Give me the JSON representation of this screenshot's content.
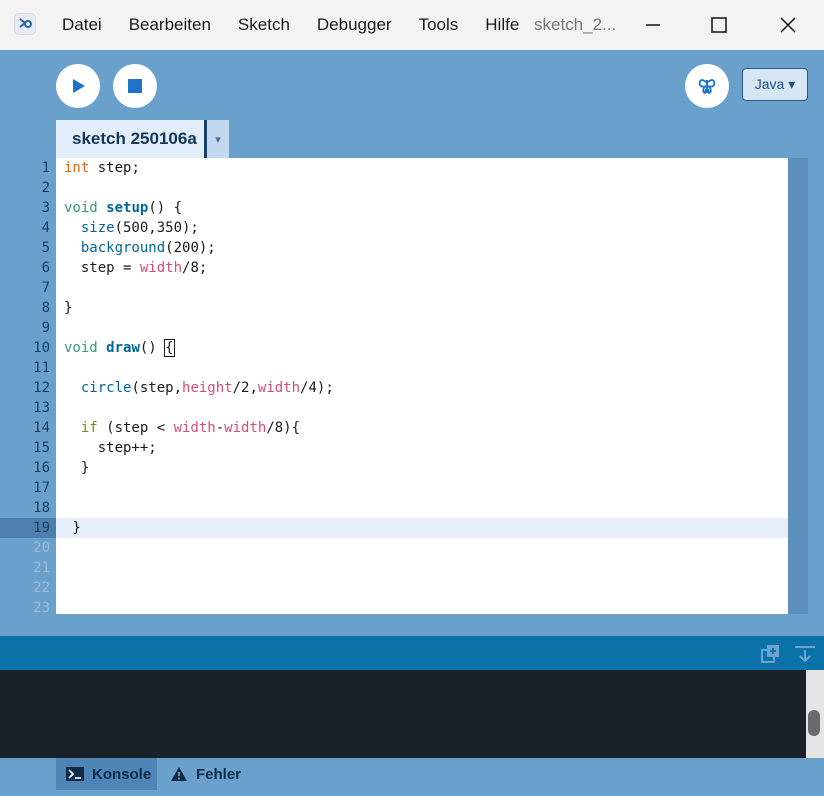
{
  "menu": {
    "items": [
      "Datei",
      "Bearbeiten",
      "Sketch",
      "Debugger",
      "Tools",
      "Hilfe"
    ],
    "window_title": "sketch_2..."
  },
  "toolbar": {
    "run_icon": "play-icon",
    "stop_icon": "stop-icon",
    "debug_icon": "butterfly-icon",
    "mode_label": "Java ▾"
  },
  "tabs": {
    "active_label": "sketch 250106a",
    "menu_glyph": "▾"
  },
  "editor": {
    "line_numbers": [
      "1",
      "2",
      "3",
      "4",
      "5",
      "6",
      "7",
      "8",
      "9",
      "10",
      "11",
      "12",
      "13",
      "14",
      "15",
      "16",
      "17",
      "18",
      "19",
      "20",
      "21",
      "22",
      "23"
    ],
    "current_line": 19,
    "code": {
      "l1_type": "int",
      "l1_rest": " step;",
      "l3_void": "void",
      "l3_name": "setup",
      "l3_rest": "() {",
      "l4_indent": "  ",
      "l4_call": "size",
      "l4_rest": "(500,350);",
      "l5_indent": "  ",
      "l5_call": "background",
      "l5_rest": "(200);",
      "l6_a": "  step = ",
      "l6_var": "width",
      "l6_b": "/8;",
      "l8": "}",
      "l10_void": "void",
      "l10_name": "draw",
      "l10_rest": "() ",
      "l10_brace": "{",
      "l12_indent": "  ",
      "l12_call": "circle",
      "l12_a": "(step,",
      "l12_v1": "height",
      "l12_b": "/2,",
      "l12_v2": "width",
      "l12_c": "/4);",
      "l14_indent": "  ",
      "l14_if": "if",
      "l14_a": " (step < ",
      "l14_v1": "width",
      "l14_b": "-",
      "l14_v2": "width",
      "l14_c": "/8){",
      "l15": "    step++;",
      "l16": "  }",
      "l19": " }"
    }
  },
  "console": {
    "add_icon": "add-console-icon",
    "collapse_icon": "collapse-panel-icon"
  },
  "bottom_tabs": {
    "console_label": "Konsole",
    "errors_label": "Fehler"
  }
}
